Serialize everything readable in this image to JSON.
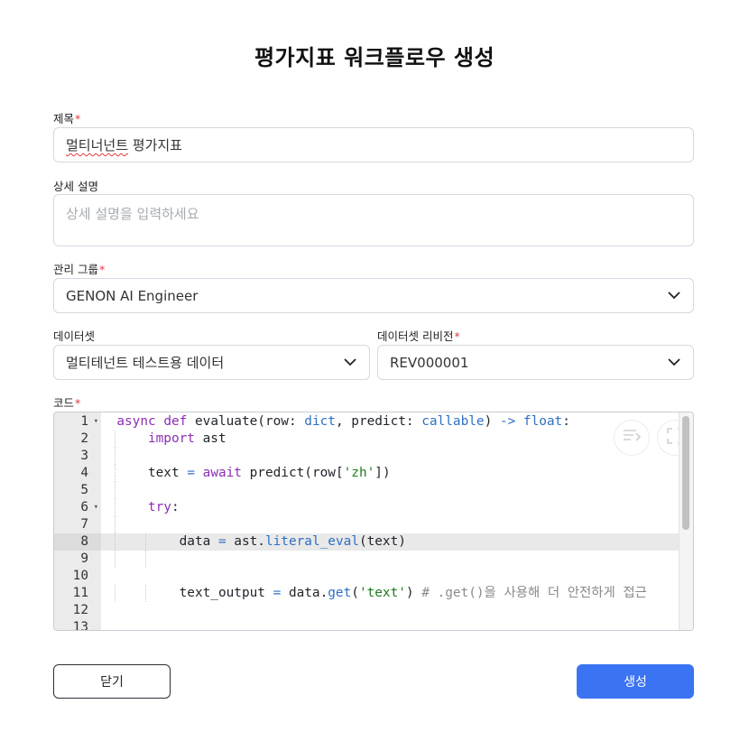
{
  "dialog": {
    "title": "평가지표 워크플로우 생성"
  },
  "form": {
    "title_field": {
      "label": "제목",
      "required_mark": "*",
      "value": "멀티너넌트 평가지표"
    },
    "description_field": {
      "label": "상세 설명",
      "placeholder": "상세 설명을 입력하세요"
    },
    "group_field": {
      "label": "관리 그룹",
      "required_mark": "*",
      "value": "GENON AI Engineer"
    },
    "dataset_field": {
      "label": "데이터셋",
      "value": "멀티테넌트 테스트용 데이터"
    },
    "revision_field": {
      "label": "데이터셋 리비전",
      "required_mark": "*",
      "value": "REV000001"
    },
    "code_field": {
      "label": "코드",
      "required_mark": "*"
    }
  },
  "editor": {
    "line_numbers": [
      "1",
      "2",
      "3",
      "4",
      "5",
      "6",
      "7",
      "8",
      "9",
      "10",
      "11",
      "12",
      "13"
    ],
    "fold_markers": {
      "1": "▾",
      "6": "▾"
    },
    "active_line": 8,
    "lines": [
      "async def evaluate(row: dict, predict: callable) -> float:",
      "    import ast",
      "",
      "    text = await predict(row['zh'])",
      "",
      "    try:",
      "",
      "        data = ast.literal_eval(text)",
      "",
      "",
      "        text_output = data.get('text') # .get()을 사용해 더 안전하게 접근",
      "",
      ""
    ],
    "tokens": {
      "l1": {
        "kw1": "async",
        "sp1": " ",
        "kw2": "def",
        "sp2": " evaluate(row: ",
        "tp1": "dict",
        "sp3": ", predict: ",
        "tp2": "callable",
        "sp4": ") ",
        "op1": "->",
        "sp5": " ",
        "tp3": "float",
        "sp6": ":"
      },
      "l2": {
        "kw": "import",
        "rest": " ast"
      },
      "l4": {
        "a": "text ",
        "op": "=",
        "b": " ",
        "kw": "await",
        "c": " predict(row[",
        "st": "'zh'",
        "d": "])"
      },
      "l6": {
        "kw": "try",
        "rest": ":"
      },
      "l8": {
        "a": "data ",
        "op": "=",
        "b": " ast.",
        "fn": "literal_eval",
        "c": "(text)"
      },
      "l11": {
        "a": "text_output ",
        "op": "=",
        "b": " data.",
        "fn": "get",
        "c": "(",
        "st": "'text'",
        "d": ") ",
        "cm": "# .get()을 사용해 더 안전하게 접근"
      }
    },
    "icons": [
      "wrap-lines-icon",
      "fullscreen-icon"
    ]
  },
  "buttons": {
    "close_label": "닫기",
    "create_label": "생성"
  },
  "colors": {
    "primary": "#3b74f2",
    "required": "#e0393e",
    "keyword": "#8b2fb3",
    "type": "#2f6fc4",
    "string": "#1f7a1f"
  }
}
